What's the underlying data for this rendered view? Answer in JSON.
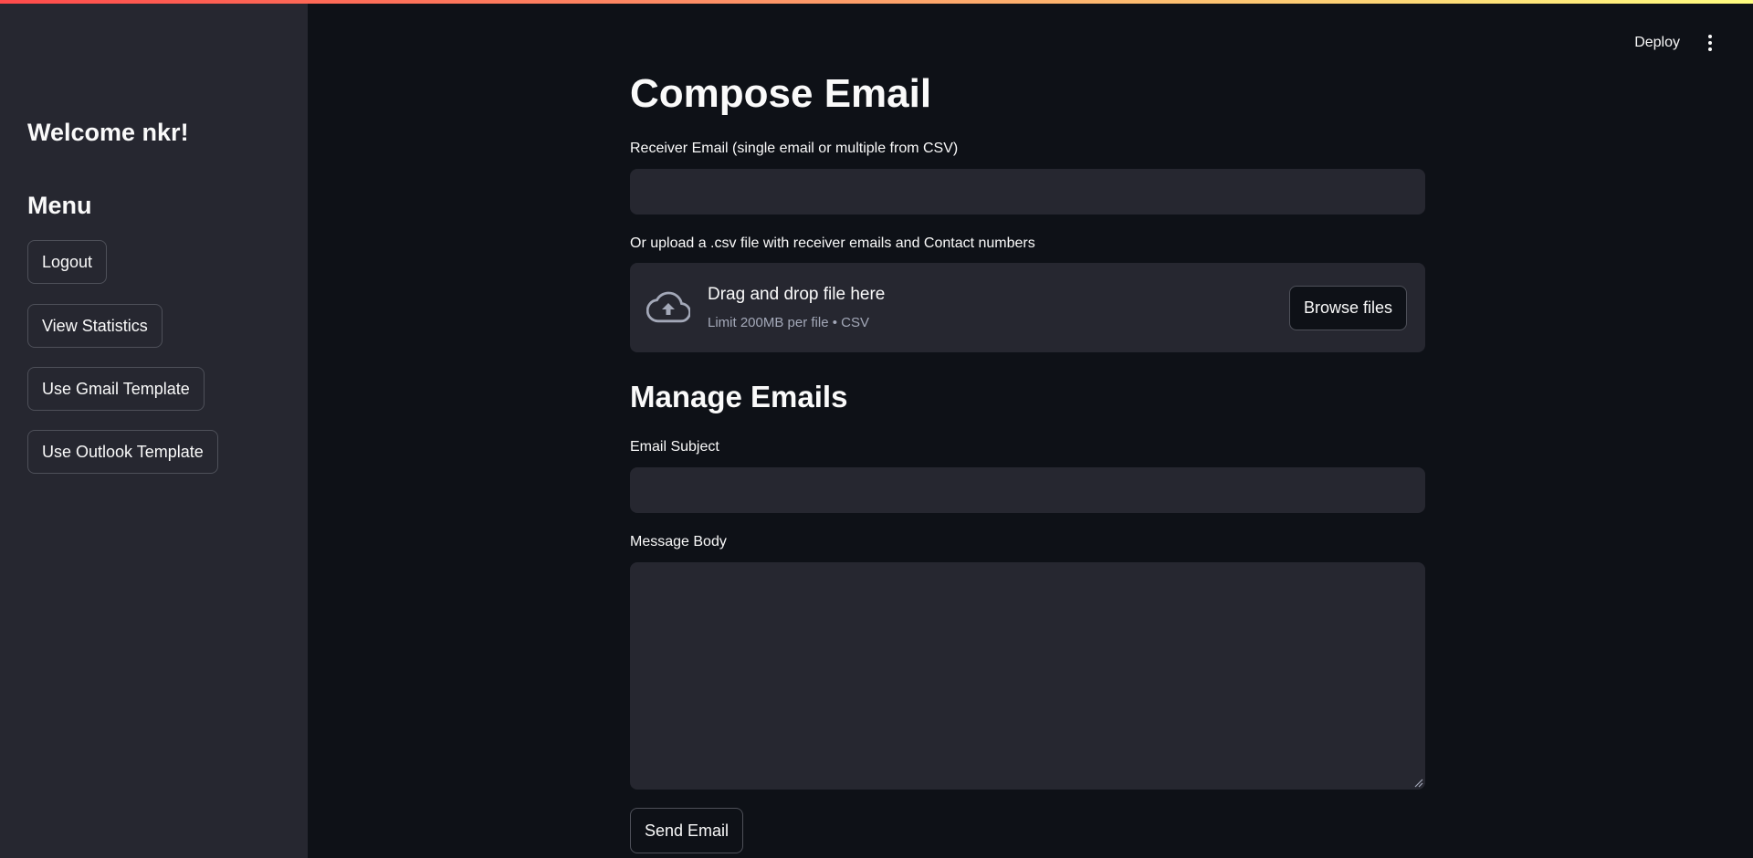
{
  "sidebar": {
    "welcome": "Welcome nkr!",
    "menu_title": "Menu",
    "buttons": [
      {
        "label": "Logout"
      },
      {
        "label": "View Statistics"
      },
      {
        "label": "Use Gmail Template"
      },
      {
        "label": "Use Outlook Template"
      }
    ]
  },
  "header": {
    "deploy_label": "Deploy",
    "menu_icon": "kebab-menu-icon"
  },
  "main": {
    "title": "Compose Email",
    "receiver": {
      "label": "Receiver Email (single email or multiple from CSV)",
      "value": ""
    },
    "upload": {
      "label": "Or upload a .csv file with receiver emails and Contact numbers",
      "icon": "cloud-upload-icon",
      "drag_text": "Drag and drop file here",
      "limit_text": "Limit 200MB per file • CSV",
      "browse_label": "Browse files"
    },
    "section_title": "Manage Emails",
    "subject": {
      "label": "Email Subject",
      "value": ""
    },
    "body": {
      "label": "Message Body",
      "value": ""
    },
    "send_label": "Send Email"
  },
  "colors": {
    "background": "#0e1117",
    "sidebar": "#262730",
    "input": "#262730",
    "text": "#fafafa",
    "muted": "#a3a8b8",
    "border": "#4e5059"
  }
}
